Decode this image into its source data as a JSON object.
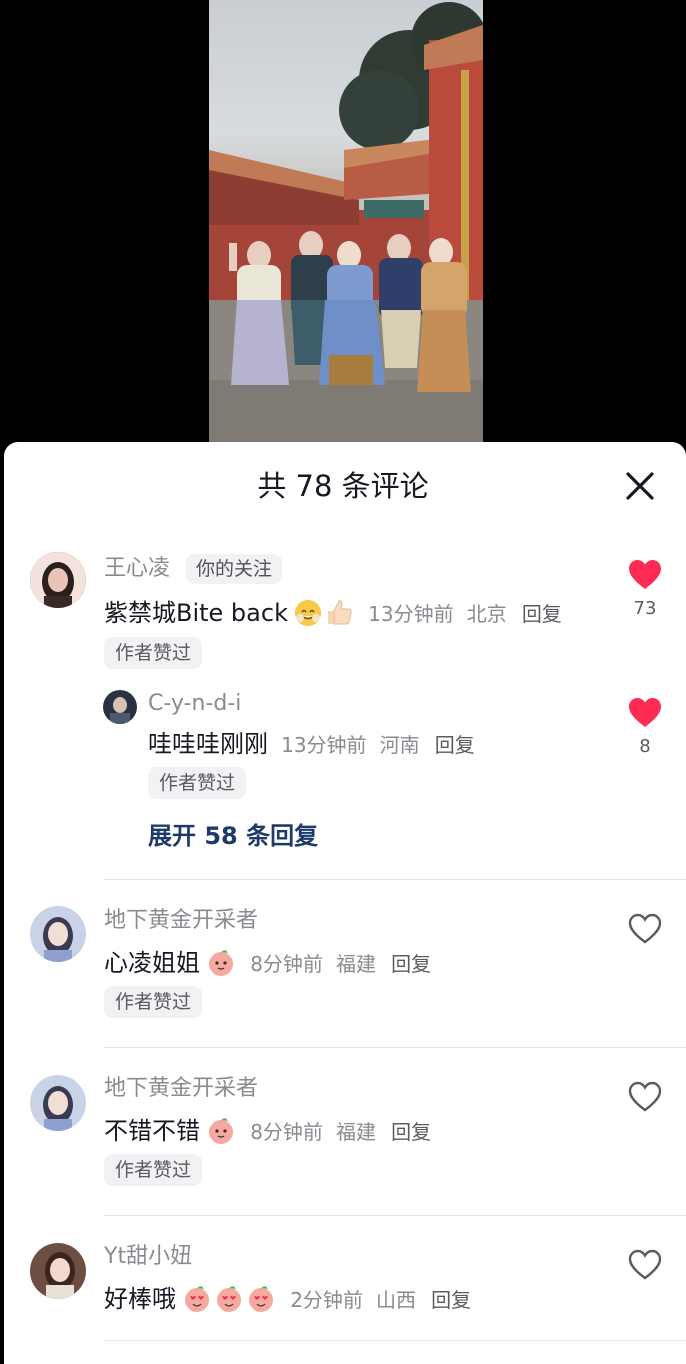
{
  "sheet": {
    "title": "共 78 条评论",
    "close_icon": "close-x-icon"
  },
  "comments": [
    {
      "username": "王心凌",
      "tag": "你的关注",
      "text": "紫禁城Bite back",
      "emojis": [
        "smile-emoji",
        "thumbs-up-emoji"
      ],
      "time": "13分钟前",
      "location": "北京",
      "reply_label": "回复",
      "author_liked": "作者赞过",
      "likes": "73",
      "liked": true,
      "replies": [
        {
          "username": "C-y-n-d-i",
          "text": "哇哇哇刚刚",
          "time": "13分钟前",
          "location": "河南",
          "reply_label": "回复",
          "author_liked": "作者赞过",
          "likes": "8",
          "liked": true
        }
      ],
      "expand_label": "展开 58 条回复"
    },
    {
      "username": "地下黄金开采者",
      "text": "心凌姐姐",
      "emojis": [
        "peach-emoji"
      ],
      "time": "8分钟前",
      "location": "福建",
      "reply_label": "回复",
      "author_liked": "作者赞过",
      "liked": false
    },
    {
      "username": "地下黄金开采者",
      "text": "不错不错",
      "emojis": [
        "peach-emoji"
      ],
      "time": "8分钟前",
      "location": "福建",
      "reply_label": "回复",
      "author_liked": "作者赞过",
      "liked": false
    },
    {
      "username": "Yt甜小妞",
      "text": "好棒哦",
      "emojis": [
        "heart-eyes-peach-emoji",
        "heart-eyes-peach-emoji",
        "heart-eyes-peach-emoji"
      ],
      "time": "2分钟前",
      "location": "山西",
      "reply_label": "回复",
      "liked": false
    }
  ],
  "colors": {
    "like_red": "#fe2c55",
    "expand_blue": "#1e3a6b",
    "meta_gray": "#8a8b91"
  }
}
